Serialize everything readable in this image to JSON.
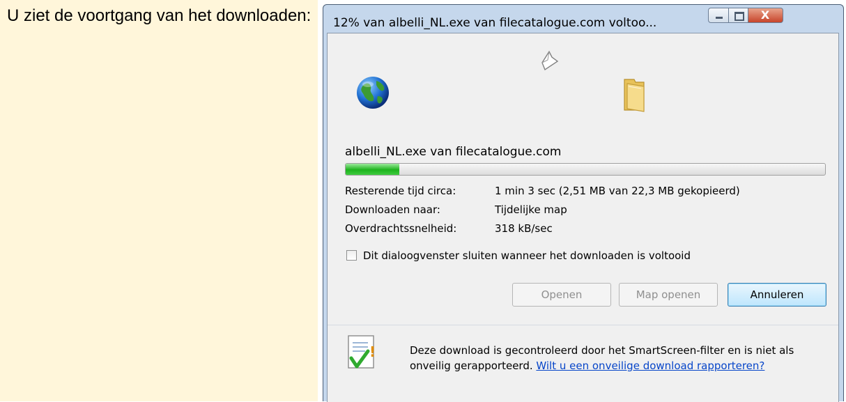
{
  "left_panel": {
    "instruction": "U ziet de voortgang van het downloaden:"
  },
  "dialog": {
    "title": "12% van albelli_NL.exe van filecatalogue.com voltoo...",
    "close_glyph": "X",
    "file_line": "albelli_NL.exe van filecatalogue.com",
    "progress_fraction": 0.112,
    "rows": {
      "time_label": "Resterende tijd circa:",
      "time_value": "1 min 3 sec (2,51 MB van 22,3 MB gekopieerd)",
      "dest_label": "Downloaden naar:",
      "dest_value": "Tijdelijke map",
      "speed_label": "Overdrachtssnelheid:",
      "speed_value": "318 kB/sec"
    },
    "close_option_label": "Dit dialoogvenster sluiten wanneer het downloaden is voltooid",
    "close_option_checked": false,
    "buttons": {
      "open": "Openen",
      "open_folder": "Map openen",
      "cancel": "Annuleren"
    },
    "smartscreen_text": "Deze download is gecontroleerd door het SmartScreen-filter en is niet als onveilig gerapporteerd.",
    "smartscreen_link": "Wilt u een onveilige download rapporteren?",
    "icons": {
      "paper": "paper-animation-icon",
      "globe": "globe-icon",
      "folder": "folder-icon",
      "shield": "smartscreen-shield-icon"
    },
    "colors": {
      "progress_green": "#1db31d",
      "link_blue": "#0645c9",
      "left_panel_bg": "#fff6da"
    }
  }
}
